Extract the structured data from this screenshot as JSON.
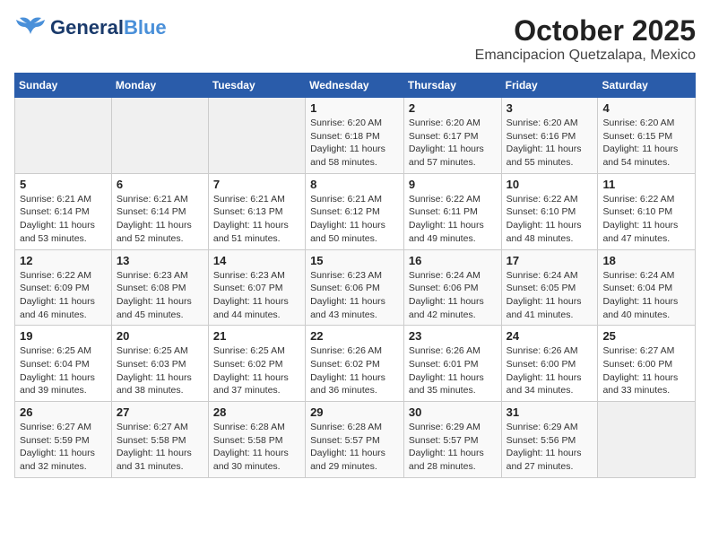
{
  "header": {
    "logo_general": "General",
    "logo_blue": "Blue",
    "title": "October 2025",
    "subtitle": "Emancipacion Quetzalapa, Mexico"
  },
  "weekdays": [
    "Sunday",
    "Monday",
    "Tuesday",
    "Wednesday",
    "Thursday",
    "Friday",
    "Saturday"
  ],
  "weeks": [
    [
      {
        "day": "",
        "empty": true
      },
      {
        "day": "",
        "empty": true
      },
      {
        "day": "",
        "empty": true
      },
      {
        "day": "1",
        "sunrise": "6:20 AM",
        "sunset": "6:18 PM",
        "daylight": "11 hours and 58 minutes."
      },
      {
        "day": "2",
        "sunrise": "6:20 AM",
        "sunset": "6:17 PM",
        "daylight": "11 hours and 57 minutes."
      },
      {
        "day": "3",
        "sunrise": "6:20 AM",
        "sunset": "6:16 PM",
        "daylight": "11 hours and 55 minutes."
      },
      {
        "day": "4",
        "sunrise": "6:20 AM",
        "sunset": "6:15 PM",
        "daylight": "11 hours and 54 minutes."
      }
    ],
    [
      {
        "day": "5",
        "sunrise": "6:21 AM",
        "sunset": "6:14 PM",
        "daylight": "11 hours and 53 minutes."
      },
      {
        "day": "6",
        "sunrise": "6:21 AM",
        "sunset": "6:14 PM",
        "daylight": "11 hours and 52 minutes."
      },
      {
        "day": "7",
        "sunrise": "6:21 AM",
        "sunset": "6:13 PM",
        "daylight": "11 hours and 51 minutes."
      },
      {
        "day": "8",
        "sunrise": "6:21 AM",
        "sunset": "6:12 PM",
        "daylight": "11 hours and 50 minutes."
      },
      {
        "day": "9",
        "sunrise": "6:22 AM",
        "sunset": "6:11 PM",
        "daylight": "11 hours and 49 minutes."
      },
      {
        "day": "10",
        "sunrise": "6:22 AM",
        "sunset": "6:10 PM",
        "daylight": "11 hours and 48 minutes."
      },
      {
        "day": "11",
        "sunrise": "6:22 AM",
        "sunset": "6:10 PM",
        "daylight": "11 hours and 47 minutes."
      }
    ],
    [
      {
        "day": "12",
        "sunrise": "6:22 AM",
        "sunset": "6:09 PM",
        "daylight": "11 hours and 46 minutes."
      },
      {
        "day": "13",
        "sunrise": "6:23 AM",
        "sunset": "6:08 PM",
        "daylight": "11 hours and 45 minutes."
      },
      {
        "day": "14",
        "sunrise": "6:23 AM",
        "sunset": "6:07 PM",
        "daylight": "11 hours and 44 minutes."
      },
      {
        "day": "15",
        "sunrise": "6:23 AM",
        "sunset": "6:06 PM",
        "daylight": "11 hours and 43 minutes."
      },
      {
        "day": "16",
        "sunrise": "6:24 AM",
        "sunset": "6:06 PM",
        "daylight": "11 hours and 42 minutes."
      },
      {
        "day": "17",
        "sunrise": "6:24 AM",
        "sunset": "6:05 PM",
        "daylight": "11 hours and 41 minutes."
      },
      {
        "day": "18",
        "sunrise": "6:24 AM",
        "sunset": "6:04 PM",
        "daylight": "11 hours and 40 minutes."
      }
    ],
    [
      {
        "day": "19",
        "sunrise": "6:25 AM",
        "sunset": "6:04 PM",
        "daylight": "11 hours and 39 minutes."
      },
      {
        "day": "20",
        "sunrise": "6:25 AM",
        "sunset": "6:03 PM",
        "daylight": "11 hours and 38 minutes."
      },
      {
        "day": "21",
        "sunrise": "6:25 AM",
        "sunset": "6:02 PM",
        "daylight": "11 hours and 37 minutes."
      },
      {
        "day": "22",
        "sunrise": "6:26 AM",
        "sunset": "6:02 PM",
        "daylight": "11 hours and 36 minutes."
      },
      {
        "day": "23",
        "sunrise": "6:26 AM",
        "sunset": "6:01 PM",
        "daylight": "11 hours and 35 minutes."
      },
      {
        "day": "24",
        "sunrise": "6:26 AM",
        "sunset": "6:00 PM",
        "daylight": "11 hours and 34 minutes."
      },
      {
        "day": "25",
        "sunrise": "6:27 AM",
        "sunset": "6:00 PM",
        "daylight": "11 hours and 33 minutes."
      }
    ],
    [
      {
        "day": "26",
        "sunrise": "6:27 AM",
        "sunset": "5:59 PM",
        "daylight": "11 hours and 32 minutes."
      },
      {
        "day": "27",
        "sunrise": "6:27 AM",
        "sunset": "5:58 PM",
        "daylight": "11 hours and 31 minutes."
      },
      {
        "day": "28",
        "sunrise": "6:28 AM",
        "sunset": "5:58 PM",
        "daylight": "11 hours and 30 minutes."
      },
      {
        "day": "29",
        "sunrise": "6:28 AM",
        "sunset": "5:57 PM",
        "daylight": "11 hours and 29 minutes."
      },
      {
        "day": "30",
        "sunrise": "6:29 AM",
        "sunset": "5:57 PM",
        "daylight": "11 hours and 28 minutes."
      },
      {
        "day": "31",
        "sunrise": "6:29 AM",
        "sunset": "5:56 PM",
        "daylight": "11 hours and 27 minutes."
      },
      {
        "day": "",
        "empty": true
      }
    ]
  ]
}
